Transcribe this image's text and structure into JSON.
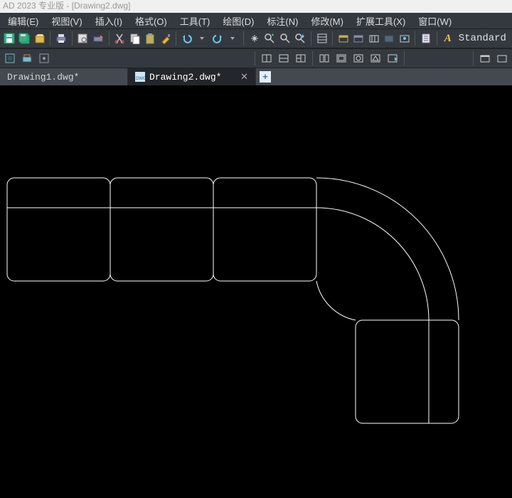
{
  "title": "AD 2023 专业版 - [Drawing2.dwg]",
  "menus": [
    {
      "label": "编辑(E)"
    },
    {
      "label": "视图(V)"
    },
    {
      "label": "插入(I)"
    },
    {
      "label": "格式(O)"
    },
    {
      "label": "工具(T)"
    },
    {
      "label": "绘图(D)"
    },
    {
      "label": "标注(N)"
    },
    {
      "label": "修改(M)"
    },
    {
      "label": "扩展工具(X)"
    },
    {
      "label": "窗口(W)"
    }
  ],
  "text_style": "Standard",
  "tabs": [
    {
      "label": "Drawing1.dwg*",
      "active": false
    },
    {
      "label": "Drawing2.dwg*",
      "active": true
    }
  ]
}
